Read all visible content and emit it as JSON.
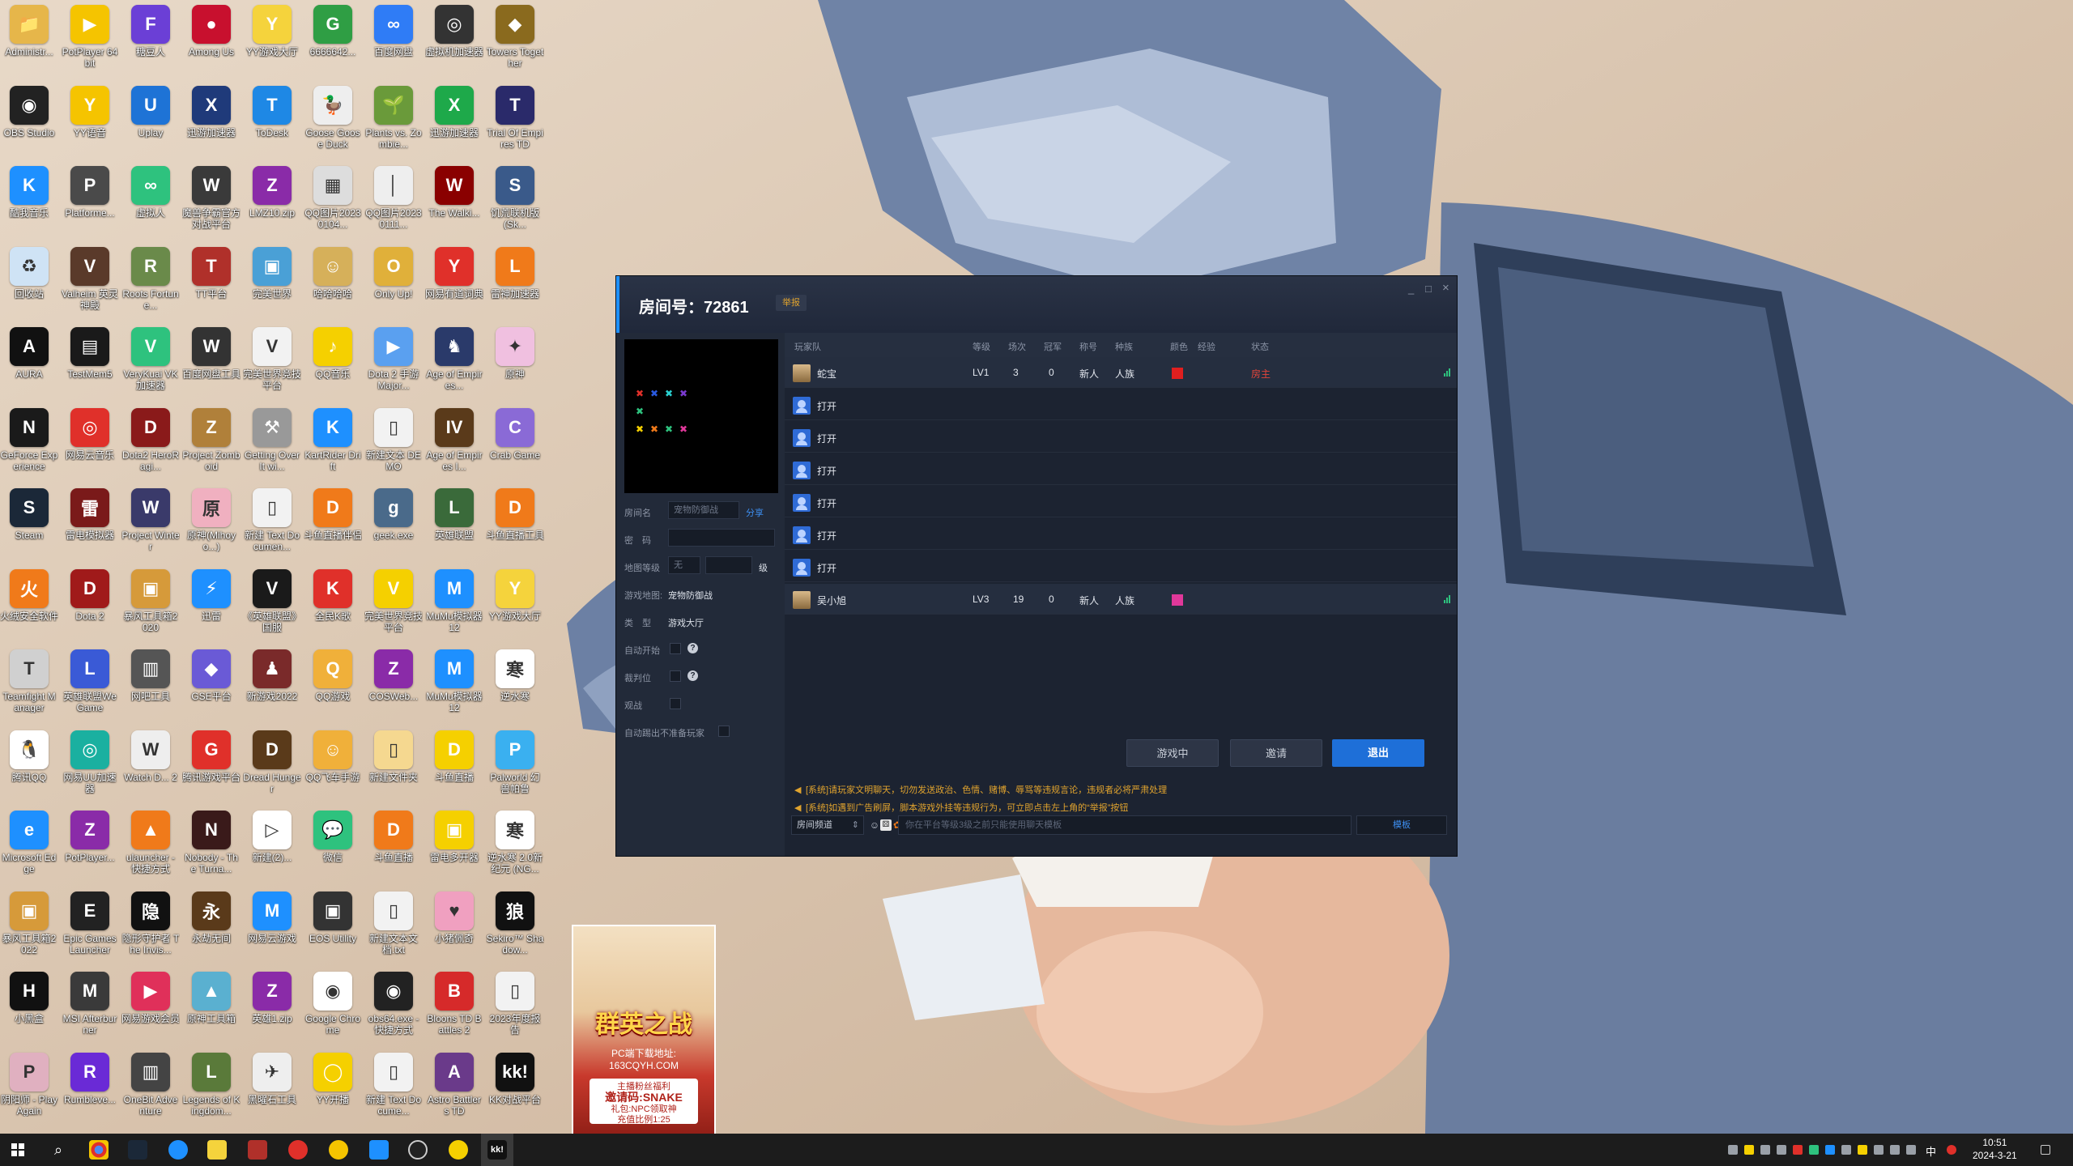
{
  "desktop_icons": [
    {
      "label": "Administr...",
      "color": "#e6b64a",
      "glyph": "📁"
    },
    {
      "label": "PotPlayer 64 bit",
      "color": "#f5c400",
      "glyph": "▶"
    },
    {
      "label": "糖豆人",
      "color": "#6b3fd6",
      "glyph": "F"
    },
    {
      "label": "Among Us",
      "color": "#c8102e",
      "glyph": "●"
    },
    {
      "label": "YY游戏大厅",
      "color": "#f5d33c",
      "glyph": "Y"
    },
    {
      "label": "6666642...",
      "color": "#2f9e44",
      "glyph": "G"
    },
    {
      "label": "百度网盘",
      "color": "#2f7cf6",
      "glyph": "∞"
    },
    {
      "label": "虚拟机加速器",
      "color": "#333",
      "glyph": "◎"
    },
    {
      "label": "Towers Together",
      "color": "#8a6a1e",
      "glyph": "◆"
    },
    {
      "label": "OBS Studio",
      "color": "#222",
      "glyph": "◉"
    },
    {
      "label": "YY语音",
      "color": "#f5c400",
      "glyph": "Y"
    },
    {
      "label": "Uplay",
      "color": "#1e73d6",
      "glyph": "U"
    },
    {
      "label": "迅游加速器",
      "color": "#1f3a7a",
      "glyph": "X"
    },
    {
      "label": "ToDesk",
      "color": "#1e88e5",
      "glyph": "T"
    },
    {
      "label": "Goose Goose Duck",
      "color": "#eee",
      "glyph": "🦆"
    },
    {
      "label": "Plants vs. Zombie...",
      "color": "#6a9a3a",
      "glyph": "🌱"
    },
    {
      "label": "迅游加速器",
      "color": "#1ea94a",
      "glyph": "X"
    },
    {
      "label": "Trial Of Empires TD",
      "color": "#2a2a6a",
      "glyph": "T"
    },
    {
      "label": "酷我音乐",
      "color": "#1e90ff",
      "glyph": "K"
    },
    {
      "label": "Platforme...",
      "color": "#4a4a4a",
      "glyph": "P"
    },
    {
      "label": "虚拟人",
      "color": "#2ec27e",
      "glyph": "∞"
    },
    {
      "label": "魔兽争霸官方对战平台",
      "color": "#3a3a3a",
      "glyph": "W"
    },
    {
      "label": "LMZ10.zip",
      "color": "#8a2ba8",
      "glyph": "Z"
    },
    {
      "label": "QQ图片20230104...",
      "color": "#ddd",
      "glyph": "▦"
    },
    {
      "label": "QQ图片20230111...",
      "color": "#eee",
      "glyph": "│"
    },
    {
      "label": "The Walki...",
      "color": "#8a0000",
      "glyph": "W"
    },
    {
      "label": "饥荒联机版 (Sk...",
      "color": "#3a5a8a",
      "glyph": "S"
    },
    {
      "label": "回收站",
      "color": "#cfe3f5",
      "glyph": "♻"
    },
    {
      "label": "Valheim 英灵神殿",
      "color": "#5a3a2a",
      "glyph": "V"
    },
    {
      "label": "Roots Fortune...",
      "color": "#6a8a4a",
      "glyph": "R"
    },
    {
      "label": "TT平台",
      "color": "#b0302a",
      "glyph": "T"
    },
    {
      "label": "完美世界",
      "color": "#4aa0d6",
      "glyph": "▣"
    },
    {
      "label": "哈哈哈哈",
      "color": "#d6b05a",
      "glyph": "☺"
    },
    {
      "label": "Only Up!",
      "color": "#e0b03a",
      "glyph": "O"
    },
    {
      "label": "网易有道词典",
      "color": "#e0302a",
      "glyph": "Y"
    },
    {
      "label": "雷神加速器",
      "color": "#f07a1a",
      "glyph": "L"
    },
    {
      "label": "AURA",
      "color": "#111",
      "glyph": "A"
    },
    {
      "label": "TestMem5",
      "color": "#1a1a1a",
      "glyph": "▤"
    },
    {
      "label": "VeryKuai VK加速器",
      "color": "#2ec27e",
      "glyph": "V"
    },
    {
      "label": "百度网盘工具",
      "color": "#333",
      "glyph": "W"
    },
    {
      "label": "完美世界竞技平台",
      "color": "#f2f2f2",
      "glyph": "V"
    },
    {
      "label": "QQ音乐",
      "color": "#f5d000",
      "glyph": "♪"
    },
    {
      "label": "Dota 2 手游 Major...",
      "color": "#5aa0f0",
      "glyph": "▶"
    },
    {
      "label": "Age of Empires...",
      "color": "#2a3a6a",
      "glyph": "♞"
    },
    {
      "label": "原神",
      "color": "#f0c0e0",
      "glyph": "✦"
    },
    {
      "label": "GeForce Experience",
      "color": "#1a1a1a",
      "glyph": "N"
    },
    {
      "label": "网易云音乐",
      "color": "#e0302a",
      "glyph": "◎"
    },
    {
      "label": "Dota2 HeroRagi...",
      "color": "#8a1a1a",
      "glyph": "D"
    },
    {
      "label": "Project Zomboid",
      "color": "#b0803a",
      "glyph": "Z"
    },
    {
      "label": "Getting Over It wi...",
      "color": "#999",
      "glyph": "⚒"
    },
    {
      "label": "KartRider Drift",
      "color": "#1e90ff",
      "glyph": "K"
    },
    {
      "label": "新建文本 DEMO",
      "color": "#f2f2f2",
      "glyph": "▯"
    },
    {
      "label": "Age of Empires I...",
      "color": "#5a3a1a",
      "glyph": "IV"
    },
    {
      "label": "Crab Game",
      "color": "#8a6ad6",
      "glyph": "C"
    },
    {
      "label": "Steam",
      "color": "#1b2838",
      "glyph": "S"
    },
    {
      "label": "雷电模拟器",
      "color": "#7a1a1a",
      "glyph": "雷"
    },
    {
      "label": "Project Winter",
      "color": "#3a3a6a",
      "glyph": "W"
    },
    {
      "label": "原神(Mihoyo...)",
      "color": "#f0b0c0",
      "glyph": "原"
    },
    {
      "label": "新建 Text Documen...",
      "color": "#f2f2f2",
      "glyph": "▯"
    },
    {
      "label": "斗鱼直播伴侣",
      "color": "#f07a1a",
      "glyph": "D"
    },
    {
      "label": "geek.exe",
      "color": "#4a6a8a",
      "glyph": "g"
    },
    {
      "label": "英雄联盟",
      "color": "#3a6a3a",
      "glyph": "L"
    },
    {
      "label": "斗鱼直播工具",
      "color": "#f07a1a",
      "glyph": "D"
    },
    {
      "label": "火绒安全软件",
      "color": "#f07a1a",
      "glyph": "火"
    },
    {
      "label": "Dota 2",
      "color": "#a01a1a",
      "glyph": "D"
    },
    {
      "label": "暴风工具箱2020",
      "color": "#d69a3a",
      "glyph": "▣"
    },
    {
      "label": "迅雷",
      "color": "#1e90ff",
      "glyph": "⚡"
    },
    {
      "label": "《英雄联盟》国服",
      "color": "#1a1a1a",
      "glyph": "V"
    },
    {
      "label": "全民K歌",
      "color": "#e0302a",
      "glyph": "K"
    },
    {
      "label": "完美世界竞技平台",
      "color": "#f5d000",
      "glyph": "V"
    },
    {
      "label": "MuMu模拟器12",
      "color": "#1e90ff",
      "glyph": "M"
    },
    {
      "label": "YY游戏大厅",
      "color": "#f5d33c",
      "glyph": "Y"
    },
    {
      "label": "Teamfight Manager",
      "color": "#d0d0d0",
      "glyph": "T"
    },
    {
      "label": "英雄联盟WeGame",
      "color": "#3a5ad6",
      "glyph": "L"
    },
    {
      "label": "网吧工具",
      "color": "#555",
      "glyph": "▥"
    },
    {
      "label": "GSE平台",
      "color": "#6a5ad6",
      "glyph": "◆"
    },
    {
      "label": "新游戏2022",
      "color": "#7a2a2a",
      "glyph": "♟"
    },
    {
      "label": "QQ游戏",
      "color": "#f0b03a",
      "glyph": "Q"
    },
    {
      "label": "COSWeb...",
      "color": "#8a2ba8",
      "glyph": "Z"
    },
    {
      "label": "MuMu模拟器12",
      "color": "#1e90ff",
      "glyph": "M"
    },
    {
      "label": "逆水寒",
      "color": "#fff",
      "glyph": "寒"
    },
    {
      "label": "腾讯QQ",
      "color": "#fff",
      "glyph": "🐧"
    },
    {
      "label": "网易UU加速器",
      "color": "#1ab0a0",
      "glyph": "◎"
    },
    {
      "label": "Watch D... 2",
      "color": "#eee",
      "glyph": "W"
    },
    {
      "label": "腾讯游戏平台",
      "color": "#e0302a",
      "glyph": "G"
    },
    {
      "label": "Dread Hunger",
      "color": "#5a3a1a",
      "glyph": "D"
    },
    {
      "label": "QQ飞车手游",
      "color": "#f0b03a",
      "glyph": "☺"
    },
    {
      "label": "新建文件夹",
      "color": "#f5d890",
      "glyph": "▯"
    },
    {
      "label": "斗鱼直播",
      "color": "#f5d000",
      "glyph": "D"
    },
    {
      "label": "Palworld 幻兽帕鲁",
      "color": "#3ab0f0",
      "glyph": "P"
    },
    {
      "label": "Microsoft Edge",
      "color": "#1e90ff",
      "glyph": "e"
    },
    {
      "label": "PotPlayer...",
      "color": "#8a2ba8",
      "glyph": "Z"
    },
    {
      "label": "ulauncher - 快捷方式",
      "color": "#f07a1a",
      "glyph": "▲"
    },
    {
      "label": "Nobody - The Turna...",
      "color": "#3a1a1a",
      "glyph": "N"
    },
    {
      "label": "新建(2)...",
      "color": "#fff",
      "glyph": "▷"
    },
    {
      "label": "微信",
      "color": "#2ec27e",
      "glyph": "💬"
    },
    {
      "label": "斗鱼直播",
      "color": "#f07a1a",
      "glyph": "D"
    },
    {
      "label": "雷电多开器",
      "color": "#f5d000",
      "glyph": "▣"
    },
    {
      "label": "逆水寒 2.0新纪元 (NG...",
      "color": "#fff",
      "glyph": "寒"
    },
    {
      "label": "暴风工具箱2022",
      "color": "#d69a3a",
      "glyph": "▣"
    },
    {
      "label": "Epic Games Launcher",
      "color": "#222",
      "glyph": "E"
    },
    {
      "label": "隐形守护者 The Invis...",
      "color": "#111",
      "glyph": "隐"
    },
    {
      "label": "永劫无间",
      "color": "#5a3a1a",
      "glyph": "永"
    },
    {
      "label": "网易云游戏",
      "color": "#1e90ff",
      "glyph": "M"
    },
    {
      "label": "EOS Utility",
      "color": "#333",
      "glyph": "▣"
    },
    {
      "label": "新建文本文档.txt",
      "color": "#f2f2f2",
      "glyph": "▯"
    },
    {
      "label": "小猪佩奇",
      "color": "#f0a0c0",
      "glyph": "♥"
    },
    {
      "label": "Sekiro™ Shadow...",
      "color": "#111",
      "glyph": "狼"
    },
    {
      "label": "小黑盒",
      "color": "#111",
      "glyph": "H"
    },
    {
      "label": "MSI Afterburner",
      "color": "#3a3a3a",
      "glyph": "M"
    },
    {
      "label": "网易游戏会员",
      "color": "#e0305a",
      "glyph": "▶"
    },
    {
      "label": "原神工具箱",
      "color": "#5ab0d0",
      "glyph": "▲"
    },
    {
      "label": "英雄1.zip",
      "color": "#8a2ba8",
      "glyph": "Z"
    },
    {
      "label": "Google Chrome",
      "color": "#fff",
      "glyph": "◉"
    },
    {
      "label": "obs64.exe - 快捷方式",
      "color": "#222",
      "glyph": "◉"
    },
    {
      "label": "Bloons TD Battles 2",
      "color": "#d62a2a",
      "glyph": "B"
    },
    {
      "label": "2023年度报告",
      "color": "#f2f2f2",
      "glyph": "▯"
    },
    {
      "label": "阴阳师 - PlayAgain",
      "color": "#e0b0c0",
      "glyph": "P"
    },
    {
      "label": "Rumbleve...",
      "color": "#6a2ad6",
      "glyph": "R"
    },
    {
      "label": "OneBit Adventure",
      "color": "#444",
      "glyph": "▥"
    },
    {
      "label": "Legends of Kingdom...",
      "color": "#5a7a3a",
      "glyph": "L"
    },
    {
      "label": "黑曜石工具",
      "color": "#eee",
      "glyph": "✈"
    },
    {
      "label": "YY开播",
      "color": "#f5d000",
      "glyph": "◯"
    },
    {
      "label": "新建 Text Docume...",
      "color": "#f2f2f2",
      "glyph": "▯"
    },
    {
      "label": "Astro Battlers TD",
      "color": "#6a3a8a",
      "glyph": "A"
    },
    {
      "label": "KK对战平台",
      "color": "#111",
      "glyph": "kk!"
    }
  ],
  "ad": {
    "title": "群英之战",
    "site_line1": "PC端下载地址:",
    "site_line2": "163CQYH.COM",
    "box_line1": "主播粉丝福利",
    "box_line2": "邀请码:SNAKE",
    "box_line3": "礼包:NPC领取神",
    "box_line4": "充值比例1:25"
  },
  "room": {
    "title": "房间号：72861",
    "report_label": "举报",
    "min_icon": "_",
    "max_icon": "□",
    "close_icon": "×",
    "left": {
      "room_name_label": "房间名",
      "room_name_value": "宠物防御战",
      "share_label": "分享",
      "password_label": "密　码",
      "map_level_label": "地图等级",
      "map_level_value": "无",
      "map_level_unit": "级",
      "game_map_label": "游戏地图:",
      "game_map_value": "宠物防御战",
      "type_label": "类　型",
      "type_value": "游戏大厅",
      "auto_start_label": "自动开始",
      "judge_label": "裁判位",
      "spectate_label": "观战",
      "auto_kick_label": "自动踢出不准备玩家"
    },
    "columns": [
      "玩家队",
      "等级",
      "场次",
      "冠军",
      "称号",
      "种族",
      "颜色",
      "经验",
      "状态"
    ],
    "players": [
      {
        "name": "蛇宝",
        "level": "LV1",
        "games": "3",
        "wins": "0",
        "title": "新人",
        "race": "人族",
        "color": "#e01f1f",
        "status": "房主",
        "filled": true
      },
      {
        "name": "打开",
        "level": "",
        "games": "",
        "wins": "",
        "title": "",
        "race": "",
        "color": "",
        "status": "",
        "filled": false
      },
      {
        "name": "打开",
        "level": "",
        "games": "",
        "wins": "",
        "title": "",
        "race": "",
        "color": "",
        "status": "",
        "filled": false
      },
      {
        "name": "打开",
        "level": "",
        "games": "",
        "wins": "",
        "title": "",
        "race": "",
        "color": "",
        "status": "",
        "filled": false
      },
      {
        "name": "打开",
        "level": "",
        "games": "",
        "wins": "",
        "title": "",
        "race": "",
        "color": "",
        "status": "",
        "filled": false
      },
      {
        "name": "打开",
        "level": "",
        "games": "",
        "wins": "",
        "title": "",
        "race": "",
        "color": "",
        "status": "",
        "filled": false
      },
      {
        "name": "打开",
        "level": "",
        "games": "",
        "wins": "",
        "title": "",
        "race": "",
        "color": "",
        "status": "",
        "filled": false
      },
      {
        "name": "吴小旭",
        "level": "LV3",
        "games": "19",
        "wins": "0",
        "title": "新人",
        "race": "人族",
        "color": "#e0389a",
        "status": "",
        "filled": true
      }
    ],
    "buttons": {
      "in_game": "游戏中",
      "invite": "邀请",
      "exit": "退出"
    },
    "messages": [
      "[系统]请玩家文明聊天，切勿发送政治、色情、赌博、辱骂等违规言论，违规者必将严肃处理",
      "[系统]如遇到广告刷屏，脚本游戏外挂等违规行为，可立即点击左上角的“举报”按钮"
    ],
    "chat": {
      "channel": "房间频道",
      "placeholder": "你在平台等级3级之前只能使用聊天模板",
      "template_label": "模板"
    }
  },
  "taskbar": {
    "time": "10:51",
    "date": "2024-3-21",
    "ime": "中",
    "apps": [
      "search",
      "chrome",
      "steam",
      "edge",
      "yy",
      "tt",
      "netease-music",
      "yy-voice",
      "kugou",
      "obs",
      "yy-live",
      "kk"
    ]
  }
}
